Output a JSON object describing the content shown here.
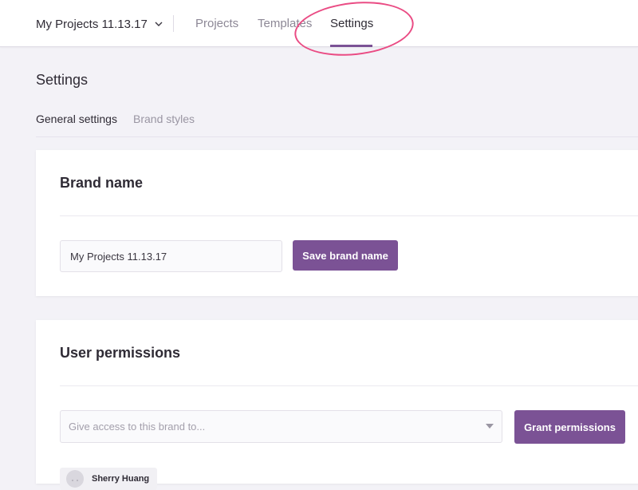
{
  "topnav": {
    "project_name": "My Projects 11.13.17",
    "tabs": [
      {
        "label": "Projects"
      },
      {
        "label": "Templates"
      },
      {
        "label": "Settings"
      }
    ],
    "active_tab": "Settings",
    "accent_color": "#7b5295",
    "highlight_color": "#ea4c84"
  },
  "page": {
    "title": "Settings",
    "subtabs": [
      {
        "label": "General settings"
      },
      {
        "label": "Brand styles"
      }
    ]
  },
  "brand_name_card": {
    "title": "Brand name",
    "input_value": "My Projects 11.13.17",
    "save_label": "Save brand name"
  },
  "permissions_card": {
    "title": "User permissions",
    "select_placeholder": "Give access to this brand to...",
    "grant_label": "Grant permissions",
    "users": [
      {
        "name": "Sherry Huang"
      }
    ]
  }
}
